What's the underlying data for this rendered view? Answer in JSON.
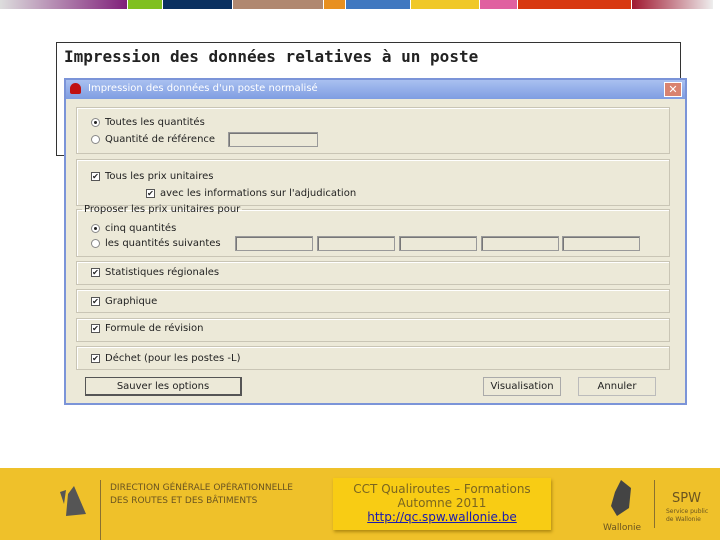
{
  "slide": {
    "title": "Impression des données relatives à un poste"
  },
  "stripes": [
    "#80207a",
    "#80c020",
    "#0a3060",
    "#b08870",
    "#e89020",
    "#4078c0",
    "#f0c828",
    "#e060a0",
    "#d83810",
    "#a01830"
  ],
  "dialog": {
    "title": "Impression des données d'un poste normalisé",
    "qty_all": "Toutes les quantités",
    "qty_ref": "Quantité de référence",
    "qty_ref_value": "",
    "all_prices": "Tous les prix unitaires",
    "adjudication": "avec les informations sur l'adjudication",
    "propose_legend": "Proposer les prix unitaires pour",
    "five_qty": "cinq quantités",
    "following_qty": "les quantités suivantes",
    "stats": "Statistiques régionales",
    "graph": "Graphique",
    "formula": "Formule de révision",
    "waste": "Déchet (pour les postes -L)",
    "save": "Sauver les options",
    "preview": "Visualisation",
    "cancel": "Annuler"
  },
  "footer": {
    "dgo_line1": "DIRECTION GÉNÉRALE OPÉRATIONNELLE",
    "dgo_line2": "DES ROUTES ET DES BÂTIMENTS",
    "dgo_logo": "DGO1",
    "cct_line1": "CCT Qualiroutes – Formations",
    "cct_line2": "Automne 2011",
    "cct_link": "http://qc.spw.wallonie.be",
    "wallonie": "Wallonie",
    "spw": "SPW",
    "spw_sub": "Service public de Wallonie"
  }
}
